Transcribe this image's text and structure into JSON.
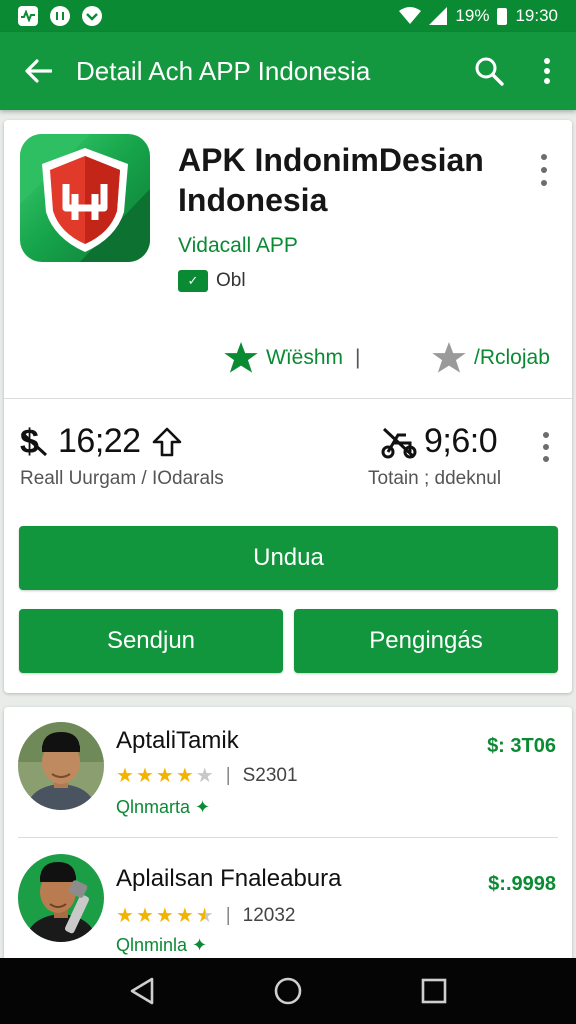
{
  "status_bar": {
    "left_icons": [
      "activity-icon",
      "voice-icon",
      "chat-icon"
    ],
    "battery": "19%",
    "time": "19:30"
  },
  "app_bar": {
    "title": "Detail Ach APP Indonesia"
  },
  "app": {
    "name": "APK IndonimDesian Indonesia",
    "developer": "Vidacall APP",
    "tag": "Obl"
  },
  "actions": {
    "wishlist": "Wïëshm",
    "wishlist_sep": "|",
    "rate": "/Rclojab"
  },
  "stats": {
    "left_value": "16;22",
    "left_label": "Reall Uurgam / IOdarals",
    "right_value": "9;6:0",
    "right_label": "Totain ; ddeknul"
  },
  "buttons": {
    "primary": "Undua",
    "secondary_left": "Sendjun",
    "secondary_right": "Pengingás"
  },
  "reviews": [
    {
      "name": "AptaliTamik",
      "rating": 4,
      "count": "S2301",
      "tag": "Qlnmarta",
      "price": "$: 3T06"
    },
    {
      "name": "Aplailsan Fnaleabura",
      "rating": 4.5,
      "count": "12032",
      "tag": "Qlnminla",
      "price": "$:.9998"
    }
  ],
  "colors": {
    "primary_green": "#13983f",
    "status_green": "#0b8a34",
    "star": "#f2b400"
  }
}
